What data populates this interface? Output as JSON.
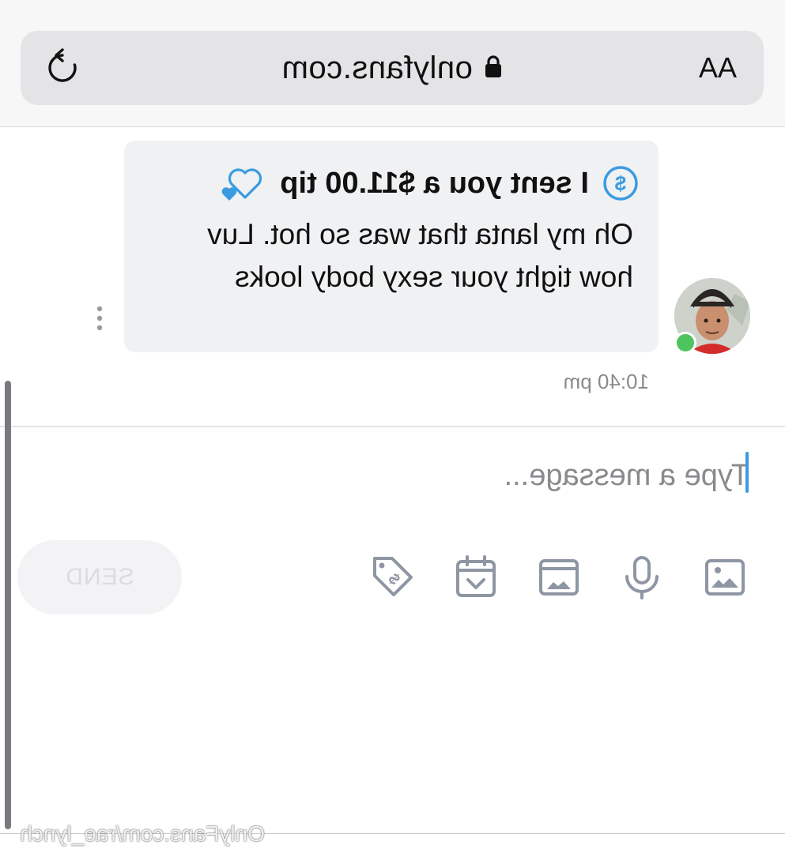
{
  "browser": {
    "text_size_label": "AA",
    "url": "onlyfans.com"
  },
  "message": {
    "tip_text": "I sent you a $11.00 tip",
    "body": "Oh my lanta that was so hot. Luv how tight your sexy body looks",
    "time": "10:40 pm"
  },
  "composer": {
    "placeholder": "Type a message...",
    "send_label": "SEND"
  },
  "icons": [
    "reload-icon",
    "lock-icon",
    "dollar-icon",
    "heart-icon",
    "more-icon",
    "image-icon",
    "microphone-icon",
    "vault-icon",
    "calendar-icon",
    "price-tag-icon"
  ],
  "colors": {
    "accent": "#3a9be0",
    "online": "#4ec45e",
    "icon_gray": "#8e96a3",
    "bubble": "#f0f1f3"
  },
  "watermark": "OnlyFans.com/rae_lynch"
}
